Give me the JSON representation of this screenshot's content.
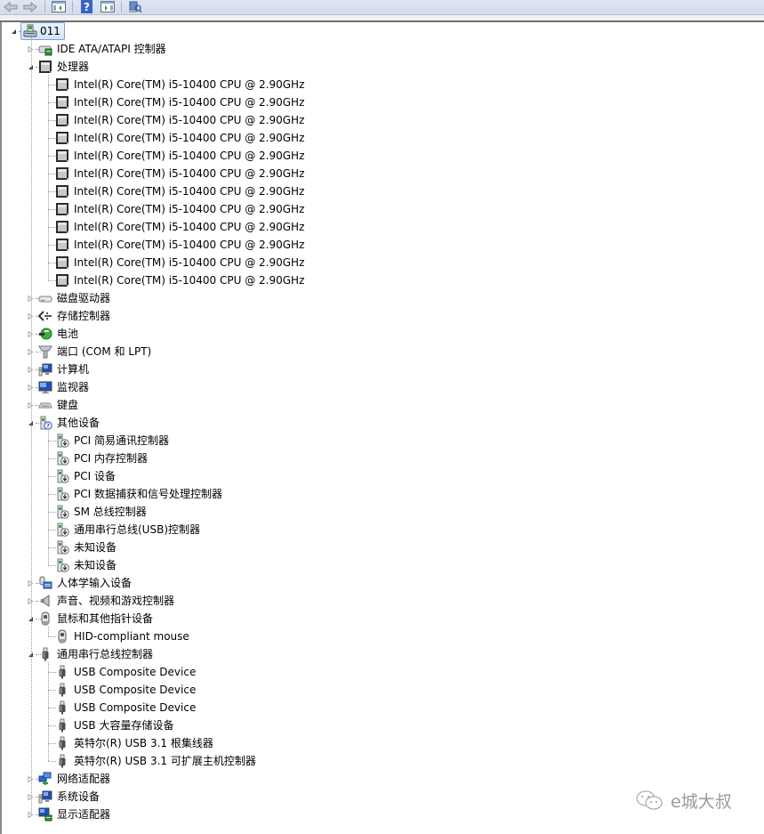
{
  "toolbar": {
    "buttons": [
      {
        "name": "back-button",
        "icon": "arrow-left-icon"
      },
      {
        "name": "forward-button",
        "icon": "arrow-right-icon"
      },
      {
        "name": "show-hide-console-tree-button",
        "icon": "console-tree-icon"
      },
      {
        "name": "help-button",
        "icon": "help-icon"
      },
      {
        "name": "show-hide-action-pane-button",
        "icon": "action-pane-icon"
      },
      {
        "name": "scan-hardware-button",
        "icon": "scan-hardware-icon"
      }
    ]
  },
  "tree": {
    "root": {
      "label": "011",
      "icon": "computer-icon",
      "expanded": true
    },
    "categories": [
      {
        "label": "IDE ATA/ATAPI 控制器",
        "icon": "ide-controller-icon",
        "expanded": false,
        "children": []
      },
      {
        "label": "处理器",
        "icon": "processor-icon",
        "expanded": true,
        "children": [
          {
            "label": "Intel(R) Core(TM) i5-10400 CPU @ 2.90GHz",
            "icon": "processor-icon"
          },
          {
            "label": "Intel(R) Core(TM) i5-10400 CPU @ 2.90GHz",
            "icon": "processor-icon"
          },
          {
            "label": "Intel(R) Core(TM) i5-10400 CPU @ 2.90GHz",
            "icon": "processor-icon"
          },
          {
            "label": "Intel(R) Core(TM) i5-10400 CPU @ 2.90GHz",
            "icon": "processor-icon"
          },
          {
            "label": "Intel(R) Core(TM) i5-10400 CPU @ 2.90GHz",
            "icon": "processor-icon"
          },
          {
            "label": "Intel(R) Core(TM) i5-10400 CPU @ 2.90GHz",
            "icon": "processor-icon"
          },
          {
            "label": "Intel(R) Core(TM) i5-10400 CPU @ 2.90GHz",
            "icon": "processor-icon"
          },
          {
            "label": "Intel(R) Core(TM) i5-10400 CPU @ 2.90GHz",
            "icon": "processor-icon"
          },
          {
            "label": "Intel(R) Core(TM) i5-10400 CPU @ 2.90GHz",
            "icon": "processor-icon"
          },
          {
            "label": "Intel(R) Core(TM) i5-10400 CPU @ 2.90GHz",
            "icon": "processor-icon"
          },
          {
            "label": "Intel(R) Core(TM) i5-10400 CPU @ 2.90GHz",
            "icon": "processor-icon"
          },
          {
            "label": "Intel(R) Core(TM) i5-10400 CPU @ 2.90GHz",
            "icon": "processor-icon"
          }
        ]
      },
      {
        "label": "磁盘驱动器",
        "icon": "disk-drive-icon",
        "expanded": false,
        "children": []
      },
      {
        "label": "存储控制器",
        "icon": "storage-controller-icon",
        "expanded": false,
        "children": []
      },
      {
        "label": "电池",
        "icon": "battery-icon",
        "expanded": false,
        "children": []
      },
      {
        "label": "端口 (COM 和 LPT)",
        "icon": "port-icon",
        "expanded": false,
        "children": []
      },
      {
        "label": "计算机",
        "icon": "computer-monitor-icon",
        "expanded": false,
        "children": []
      },
      {
        "label": "监视器",
        "icon": "monitor-icon",
        "expanded": false,
        "children": []
      },
      {
        "label": "键盘",
        "icon": "keyboard-icon",
        "expanded": false,
        "children": []
      },
      {
        "label": "其他设备",
        "icon": "unknown-device-icon",
        "expanded": true,
        "children": [
          {
            "label": "PCI 简易通讯控制器",
            "icon": "unknown-device-warning-icon"
          },
          {
            "label": "PCI 内存控制器",
            "icon": "unknown-device-warning-icon"
          },
          {
            "label": "PCI 设备",
            "icon": "unknown-device-warning-icon"
          },
          {
            "label": "PCI 数据捕获和信号处理控制器",
            "icon": "unknown-device-warning-icon"
          },
          {
            "label": "SM 总线控制器",
            "icon": "unknown-device-warning-icon"
          },
          {
            "label": "通用串行总线(USB)控制器",
            "icon": "unknown-device-warning-icon"
          },
          {
            "label": "未知设备",
            "icon": "unknown-device-warning-icon"
          },
          {
            "label": "未知设备",
            "icon": "unknown-device-warning-icon"
          }
        ]
      },
      {
        "label": "人体学输入设备",
        "icon": "hid-icon",
        "expanded": false,
        "children": []
      },
      {
        "label": "声音、视频和游戏控制器",
        "icon": "speaker-icon",
        "expanded": false,
        "children": []
      },
      {
        "label": "鼠标和其他指针设备",
        "icon": "mouse-icon",
        "expanded": true,
        "children": [
          {
            "label": "HID-compliant mouse",
            "icon": "mouse-icon"
          }
        ]
      },
      {
        "label": "通用串行总线控制器",
        "icon": "usb-icon",
        "expanded": true,
        "children": [
          {
            "label": "USB Composite Device",
            "icon": "usb-icon"
          },
          {
            "label": "USB Composite Device",
            "icon": "usb-icon"
          },
          {
            "label": "USB Composite Device",
            "icon": "usb-icon"
          },
          {
            "label": "USB 大容量存储设备",
            "icon": "usb-icon"
          },
          {
            "label": "英特尔(R) USB 3.1 根集线器",
            "icon": "usb-icon"
          },
          {
            "label": "英特尔(R) USB 3.1 可扩展主机控制器",
            "icon": "usb-icon"
          }
        ]
      },
      {
        "label": "网络适配器",
        "icon": "network-adapter-icon",
        "expanded": false,
        "children": []
      },
      {
        "label": "系统设备",
        "icon": "system-device-icon",
        "expanded": false,
        "children": []
      },
      {
        "label": "显示适配器",
        "icon": "display-adapter-icon",
        "expanded": false,
        "children": []
      }
    ]
  },
  "watermark": {
    "text": "e城大叔",
    "icon": "wechat-icon"
  }
}
